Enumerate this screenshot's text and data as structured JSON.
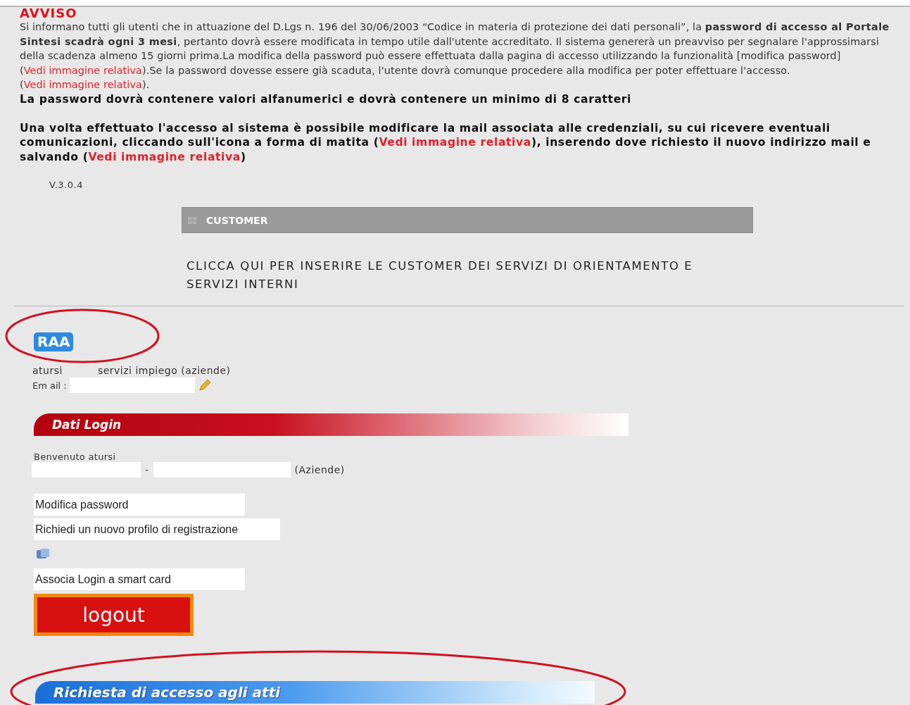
{
  "notice": {
    "title": "AVVISO",
    "paragraphs": [
      {
        "kind": "plain",
        "segments": [
          {
            "kind": "plain",
            "text": "Si informano tutti gli utenti che in attuazione del D.Lgs n. 196 del 30/06/2003 “Codice in materia di protezione dei dati personali”, la "
          },
          {
            "kind": "bold",
            "text": "password di accesso al Portale Sintesi scadrà ogni 3 mesi"
          },
          {
            "kind": "plain",
            "text": ", pertanto dovrà essere modificata in tempo utile dall'utente accreditato. Il sistema genererà un preavviso per segnalare l'approssimarsi della scadenza almeno 15 giorni prima.La modifica della password può essere effettuata dalla pagina di accesso utilizzando la funzionalità [modifica password] ("
          },
          {
            "kind": "link",
            "text": "Vedi immagine relativa"
          },
          {
            "kind": "plain",
            "text": ").Se la password dovesse essere già scaduta, l'utente dovrà comunque procedere alla modifica per poter effettuare l'accesso. ("
          },
          {
            "kind": "link",
            "text": "Vedi immagine relativa"
          },
          {
            "kind": "plain",
            "text": ")."
          }
        ]
      },
      {
        "kind": "emphasis",
        "segments": [
          {
            "kind": "plain",
            "text": "La password dovrà contenere valori alfanumerici e dovrà contenere  un minimo di 8 caratteri"
          }
        ]
      },
      {
        "kind": "emphasis",
        "segments": [
          {
            "kind": "plain",
            "text": "Una volta effettuato l'accesso al sistema è possibile modificare la mail associata alle credenziali, su cui ricevere eventuali comunicazioni, cliccando sull'icona a forma di matita ("
          },
          {
            "kind": "link",
            "text": "Vedi immagine relativa"
          },
          {
            "kind": "plain",
            "text": "), inserendo dove richiesto il nuovo indirizzo mail e salvando ("
          },
          {
            "kind": "link",
            "text": "Vedi immagine relativa"
          },
          {
            "kind": "plain",
            "text": ")"
          }
        ]
      }
    ]
  },
  "version": "V.3.0.4",
  "customer": {
    "title": "CUSTOMER",
    "link": "CLICCA QUI PER INSERIRE LE CUSTOMER DEI SERVIZI DI ORIENTAMENTO E SERVIZI INTERNI"
  },
  "profile": {
    "badge": "RAA",
    "user_line": [
      "atursi",
      "servizi impiego (aziende)"
    ],
    "email_label": "Em ail :"
  },
  "login": {
    "title": "Dati Login",
    "welcome": "Benvenuto atursi",
    "separator": "-",
    "suffix": "(Aziende)",
    "items": [
      {
        "kind": "link",
        "label": "Modifica password"
      },
      {
        "kind": "link",
        "label": "Richiedi un nuovo profilo di registrazione"
      },
      {
        "kind": "icon"
      },
      {
        "kind": "link",
        "label": "Associa Login a smart card"
      }
    ],
    "logout": "logout"
  },
  "access": {
    "title": "Richiesta di accesso agli atti"
  }
}
